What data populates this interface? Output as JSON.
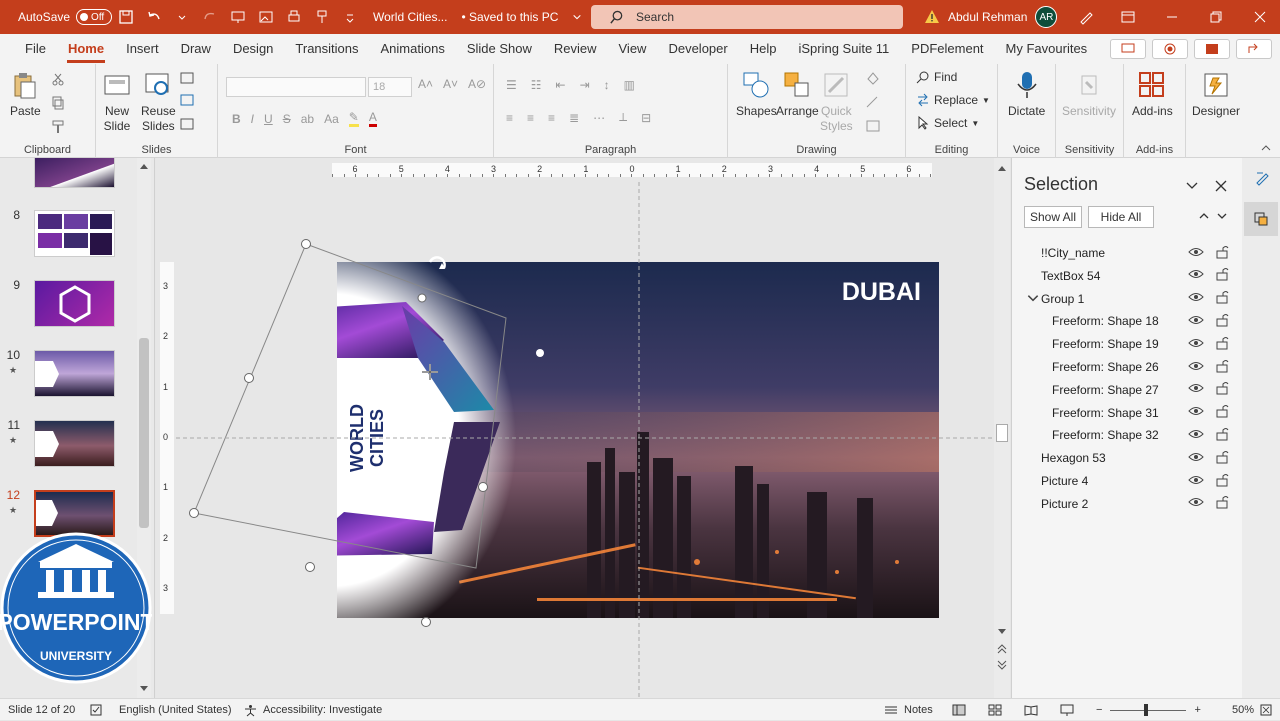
{
  "titlebar": {
    "autosave_label": "AutoSave",
    "autosave_state": "Off",
    "doc_title": "World Cities...",
    "save_status": "• Saved to this PC",
    "search_placeholder": "Search",
    "user_name": "Abdul Rehman",
    "user_initials": "AR",
    "brand_color": "#c43e1c"
  },
  "menu": {
    "tabs": [
      "File",
      "Home",
      "Insert",
      "Draw",
      "Design",
      "Transitions",
      "Animations",
      "Slide Show",
      "Review",
      "View",
      "Developer",
      "Help",
      "iSpring Suite 11",
      "PDFelement",
      "My Favourites"
    ],
    "active": "Home"
  },
  "ribbon": {
    "clipboard": {
      "label": "Clipboard",
      "paste": "Paste"
    },
    "slides": {
      "label": "Slides",
      "new_slide": "New",
      "new_slide2": "Slide",
      "reuse": "Reuse",
      "reuse2": "Slides"
    },
    "font": {
      "label": "Font",
      "size": "18"
    },
    "paragraph": {
      "label": "Paragraph"
    },
    "drawing": {
      "label": "Drawing",
      "shapes": "Shapes",
      "arrange": "Arrange",
      "quick1": "Quick",
      "quick2": "Styles"
    },
    "editing": {
      "label": "Editing",
      "find": "Find",
      "replace": "Replace",
      "select": "Select"
    },
    "voice": {
      "label": "Voice",
      "dictate": "Dictate"
    },
    "sensitivity": {
      "label": "Sensitivity",
      "btn": "Sensitivity"
    },
    "addins": {
      "label": "Add-ins",
      "btn": "Add-ins"
    },
    "designer": {
      "btn": "Designer"
    }
  },
  "thumbnails": [
    {
      "num": "8",
      "star": ""
    },
    {
      "num": "9",
      "star": ""
    },
    {
      "num": "10",
      "star": "★"
    },
    {
      "num": "11",
      "star": "★"
    },
    {
      "num": "12",
      "star": "★"
    }
  ],
  "logo": {
    "line1": "POWERPOINT",
    "line2": "UNIVERSITY"
  },
  "ruler": {
    "h_ticks": [
      "6",
      "5",
      "4",
      "3",
      "2",
      "1",
      "0",
      "1",
      "2",
      "3",
      "4",
      "5",
      "6"
    ],
    "v_ticks": [
      "3",
      "2",
      "1",
      "0",
      "1",
      "2",
      "3"
    ]
  },
  "slide": {
    "city": "DUBAI",
    "badge_line1": "WORLD",
    "badge_line2": "CITIES",
    "watermark": "POWERPOINT UNIVERSITY"
  },
  "selection_pane": {
    "title": "Selection",
    "show_all": "Show All",
    "hide_all": "Hide All",
    "items": [
      {
        "label": "!!City_name",
        "indent": 0
      },
      {
        "label": "TextBox 54",
        "indent": 0
      },
      {
        "label": "Group 1",
        "indent": 0,
        "group": true
      },
      {
        "label": "Freeform: Shape 18",
        "indent": 1
      },
      {
        "label": "Freeform: Shape 19",
        "indent": 1
      },
      {
        "label": "Freeform: Shape 26",
        "indent": 1
      },
      {
        "label": "Freeform: Shape 27",
        "indent": 1
      },
      {
        "label": "Freeform: Shape 31",
        "indent": 1
      },
      {
        "label": "Freeform: Shape 32",
        "indent": 1
      },
      {
        "label": "Hexagon 53",
        "indent": 0
      },
      {
        "label": "Picture 4",
        "indent": 0
      },
      {
        "label": "Picture 2",
        "indent": 0
      }
    ]
  },
  "status": {
    "slide": "Slide 12 of 20",
    "language": "English (United States)",
    "accessibility": "Accessibility: Investigate",
    "notes": "Notes",
    "zoom": "50%"
  }
}
